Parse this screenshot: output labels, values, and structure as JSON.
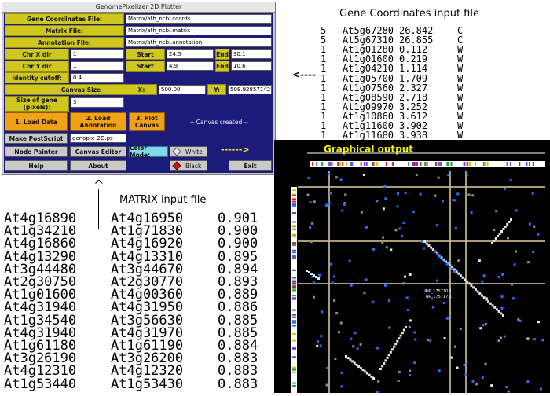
{
  "window": {
    "title": "GenomePixelizer 2D Plotter",
    "gene_coords_label": "Gene Coordinates File:",
    "gene_coords_value": "Matrix/ath_ncbi.coords",
    "matrix_label": "Matrix File:",
    "matrix_value": "Matrix/ath_ncbi.matrix",
    "annotation_label": "Annotation File:",
    "annotation_value": "Matrix/ath_ncbi.annotation",
    "chr_x_label": "Chr X dir",
    "chr_x_value": "1",
    "chr_y_label": "Chr Y dir",
    "chr_y_value": "1",
    "start_label": "Start",
    "end_label": "End",
    "x_start": "24.5",
    "x_end": "30.1",
    "y_start": "4.9",
    "y_end": "10.6",
    "identity_label": "Identity cutoff:",
    "identity_value": "0.4",
    "canvas_size_label": "Canvas Size",
    "x_label": "X:",
    "x_value": "500.00",
    "y_label": "Y:",
    "y_value": "508.928571428",
    "gene_size_label": "Size of gene (pixels):",
    "gene_size_value": "3",
    "load_data": "1. Load Data",
    "load_annotation": "2. Load Annotation",
    "plot_canvas": "3. Plot Canvas",
    "status": "-- Canvas created --",
    "make_postscript": "Make PostScript",
    "postscript_file": "genopix_2D.ps",
    "node_painter": "Node Painter",
    "canvas_editor": "Canvas Editor",
    "color_mode": "Color Mode:",
    "white": "White",
    "black": "Black",
    "help": "Help",
    "about": "About",
    "exit": "Exit"
  },
  "labels": {
    "gene_coords_heading": "Gene Coordinates input file",
    "matrix_heading": "MATRIX input file",
    "graphical_output": "Graphical output",
    "np1": "NP_175710.1",
    "np2": "NP_175717.1",
    "arrow_left": "<----",
    "arrow_up": "^",
    "arrow_right": "------>"
  },
  "coords": [
    {
      "chr": "5",
      "gene": "At5g67280",
      "pos": "26.842",
      "strand": "C"
    },
    {
      "chr": "5",
      "gene": "At5g67310",
      "pos": "26.855",
      "strand": "C"
    },
    {
      "chr": "1",
      "gene": "At1g01280",
      "pos": "0.112",
      "strand": "W"
    },
    {
      "chr": "1",
      "gene": "At1g01600",
      "pos": "0.219",
      "strand": "W"
    },
    {
      "chr": "1",
      "gene": "At1g04210",
      "pos": "1.114",
      "strand": "W"
    },
    {
      "chr": "1",
      "gene": "At1g05700",
      "pos": "1.709",
      "strand": "W"
    },
    {
      "chr": "1",
      "gene": "At1g07560",
      "pos": "2.327",
      "strand": "W"
    },
    {
      "chr": "1",
      "gene": "At1g08590",
      "pos": "2.718",
      "strand": "W"
    },
    {
      "chr": "1",
      "gene": "At1g09970",
      "pos": "3.252",
      "strand": "W"
    },
    {
      "chr": "1",
      "gene": "At1g10860",
      "pos": "3.612",
      "strand": "W"
    },
    {
      "chr": "1",
      "gene": "At1g11600",
      "pos": "3.902",
      "strand": "W"
    },
    {
      "chr": "1",
      "gene": "At1g11680",
      "pos": "3.938",
      "strand": "W"
    }
  ],
  "matrix": [
    {
      "a": "At4g16890",
      "b": "At4g16950",
      "v": "0.901"
    },
    {
      "a": "At1g34210",
      "b": "At1g71830",
      "v": "0.900"
    },
    {
      "a": "At4g16860",
      "b": "At4g16920",
      "v": "0.900"
    },
    {
      "a": "At4g13290",
      "b": "At4g13310",
      "v": "0.895"
    },
    {
      "a": "At3g44480",
      "b": "At3g44670",
      "v": "0.894"
    },
    {
      "a": "At2g30750",
      "b": "At2g30770",
      "v": "0.893"
    },
    {
      "a": "At1g01600",
      "b": "At4g00360",
      "v": "0.889"
    },
    {
      "a": "At4g31940",
      "b": "At4g31950",
      "v": "0.886"
    },
    {
      "a": "At1g34540",
      "b": "At3g56630",
      "v": "0.885"
    },
    {
      "a": "At4g31940",
      "b": "At4g31970",
      "v": "0.885"
    },
    {
      "a": "At1g61180",
      "b": "At1g61190",
      "v": "0.884"
    },
    {
      "a": "At3g26190",
      "b": "At3g26200",
      "v": "0.883"
    },
    {
      "a": "At4g12310",
      "b": "At4g12320",
      "v": "0.883"
    },
    {
      "a": "At1g53440",
      "b": "At1g53430",
      "v": "0.883"
    }
  ],
  "colors": {
    "panel": "#1c1a7a",
    "label_yellow": "#cfc61e",
    "button_orange": "#f1a214",
    "plot_bg": "#000000",
    "gridline": "#c8b98a",
    "dot_blue": "#2f6dff",
    "dot_gray": "#8f8f8f",
    "dot_white": "#e6e6e6",
    "graphical_output_yellow": "#f5f000"
  }
}
